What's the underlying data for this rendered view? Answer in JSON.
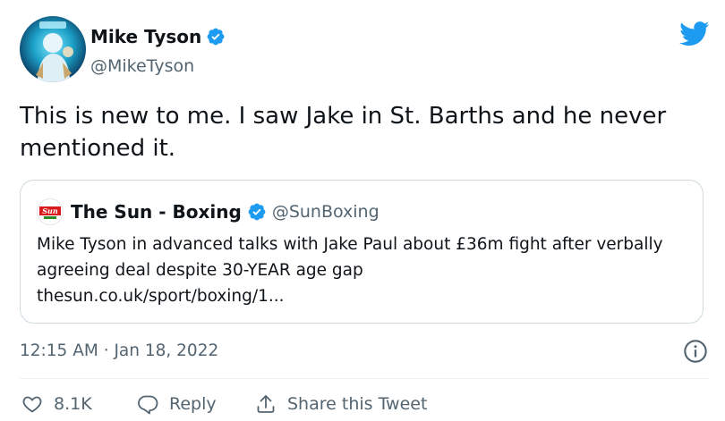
{
  "author": {
    "name": "Mike Tyson",
    "handle": "@MikeTyson",
    "avatar_icon": "fighter-avatar-icon",
    "verified_icon": "verified-badge-icon"
  },
  "brand_icon": "twitter-bird-icon",
  "tweet": {
    "text": "This is new to me. I saw Jake in St. Barths and he never mentioned it."
  },
  "quote": {
    "avatar_text": "Sun",
    "avatar_subtext": "BOXING",
    "name": "The Sun - Boxing",
    "handle": "@SunBoxing",
    "text": "Mike Tyson in advanced talks with Jake Paul about £36m fight after verbally agreeing deal despite 30-YEAR age gap",
    "link": "thesun.co.uk/sport/boxing/1..."
  },
  "timestamp": "12:15 AM · Jan 18, 2022",
  "actions": {
    "like_count": "8.1K",
    "reply_label": "Reply",
    "share_label": "Share this Tweet"
  },
  "colors": {
    "verified": "#1d9bf0",
    "twitter_blue": "#1d9bf0",
    "secondary_text": "#536471",
    "border": "#cfd9de"
  }
}
